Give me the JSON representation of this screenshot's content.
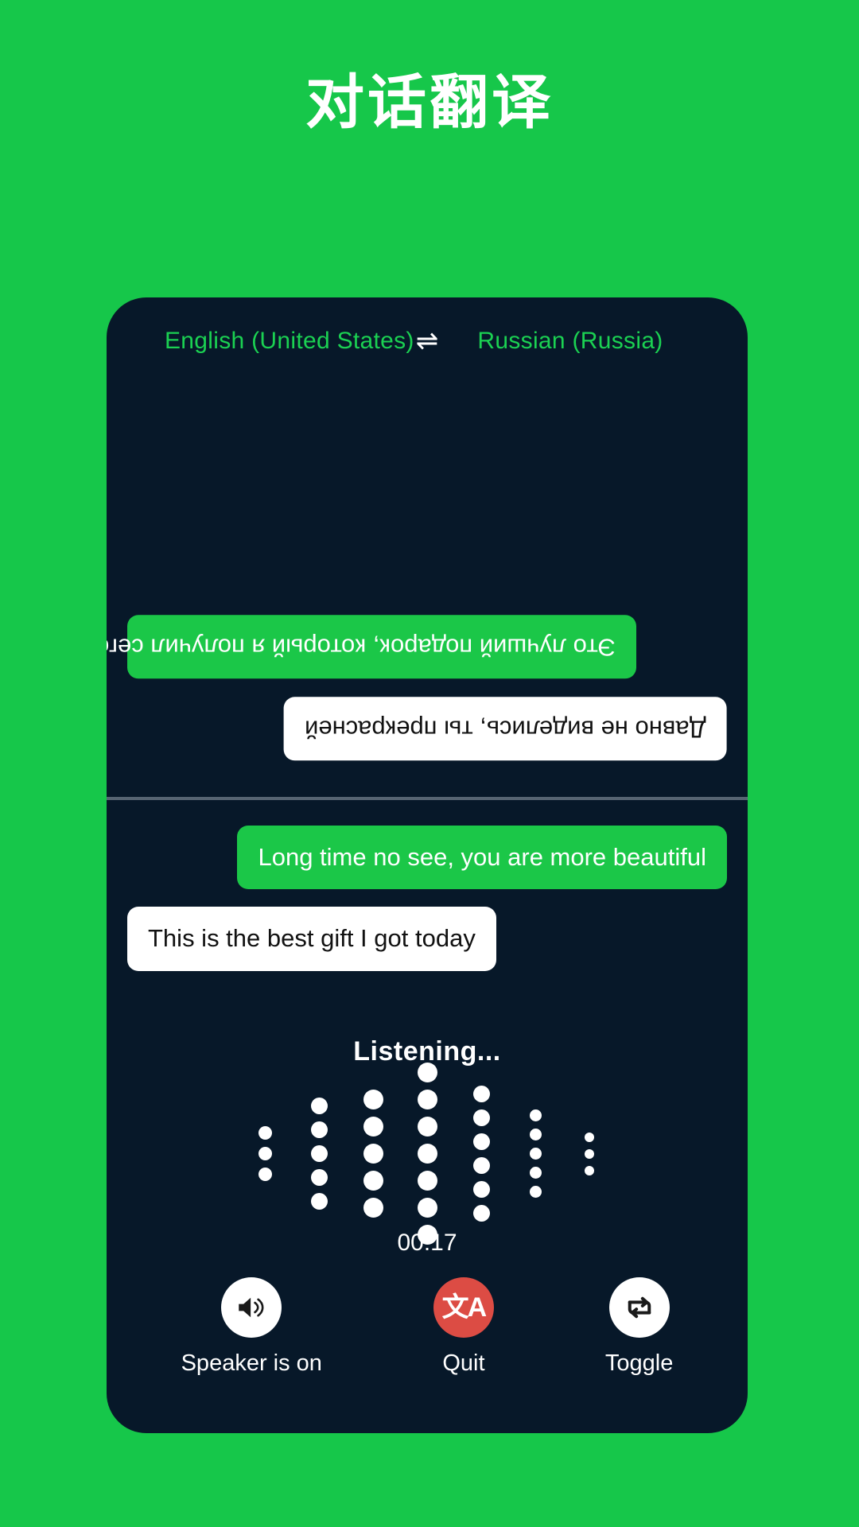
{
  "page": {
    "title": "对话翻译",
    "background_color": "#16C74A",
    "panel_color": "#071829"
  },
  "language_bar": {
    "source_language": "English (United States)",
    "target_language": "Russian (Russia)",
    "swap_icon": "⇌",
    "accent_color": "#1BD152"
  },
  "conversation": {
    "top_panel": {
      "orientation": "rotated-180",
      "messages": [
        {
          "text": "Это лучший подарок, который я получил сегодня",
          "style": "green",
          "align": "left"
        },
        {
          "text": "Давно не виделись, ты прекрасней",
          "style": "white",
          "align": "right"
        }
      ]
    },
    "bottom_panel": {
      "orientation": "normal",
      "messages": [
        {
          "text": "Long time no see, you are more beautiful",
          "style": "green",
          "align": "right"
        },
        {
          "text": "This is the best gift I got today",
          "style": "white",
          "align": "left"
        }
      ]
    }
  },
  "listening": {
    "label": "Listening...",
    "timer": "00:17",
    "waveform": {
      "columns": [
        {
          "dots": 3,
          "size": 17
        },
        {
          "dots": 5,
          "size": 21
        },
        {
          "dots": 5,
          "size": 25
        },
        {
          "dots": 7,
          "size": 25
        },
        {
          "dots": 6,
          "size": 21
        },
        {
          "dots": 5,
          "size": 15
        },
        {
          "dots": 3,
          "size": 12
        }
      ],
      "dot_color": "#ffffff"
    }
  },
  "controls": [
    {
      "label": "Speaker is on",
      "icon": "speaker-icon",
      "circle_color": "#ffffff"
    },
    {
      "label": "Quit",
      "icon": "translate-icon",
      "circle_color": "#DC4C44",
      "glyph": "文A"
    },
    {
      "label": "Toggle",
      "icon": "repeat-swap-icon",
      "circle_color": "#ffffff"
    }
  ]
}
